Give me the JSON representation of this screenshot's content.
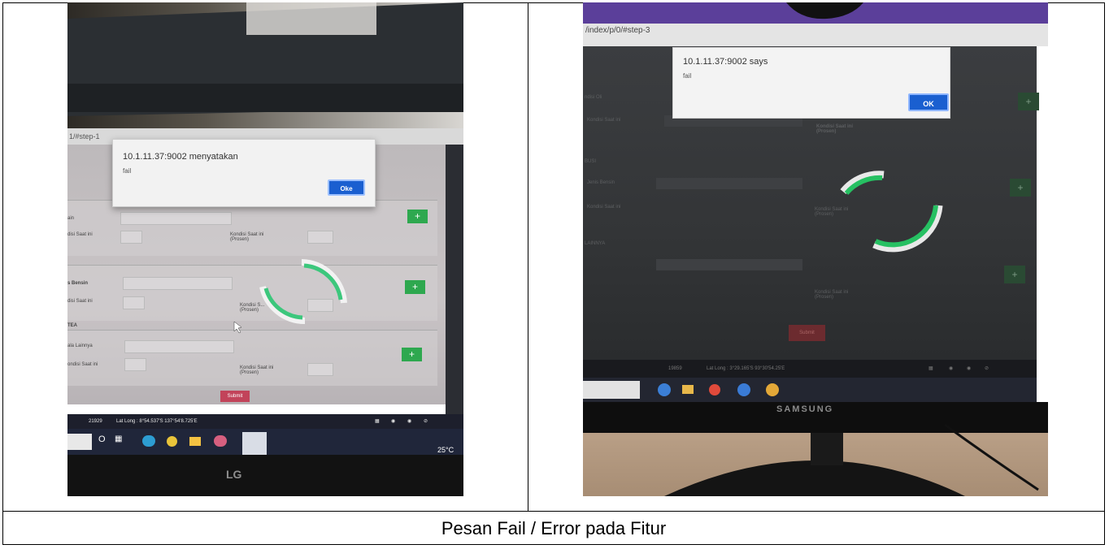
{
  "caption": "Pesan Fail / Error pada Fitur",
  "photo1": {
    "url_fragment": "1/#step-1",
    "dialog_title": "10.1.11.37:9002 menyatakan",
    "dialog_message": "fail",
    "ok_label": "Oke",
    "form_labels": [
      "ain",
      "disi Saat ini",
      "Kondisi Saat ini (Prosen)",
      "s Bensin",
      "disi Saat ini",
      "Kondisi S... (Prosen)",
      "TEA",
      "ala Lainnya",
      "ondisi Saat ini",
      "Kondisi Saat ini (Prosen)"
    ],
    "submit_label": "Submit",
    "status_text": "21929",
    "latlong": "Lat Long : 8°54.537'S 137°54'8.725'E",
    "temperature": "25°C",
    "brand": "LG"
  },
  "photo2": {
    "url_fragment": "/index/p/0/#step-3",
    "dialog_title": "10.1.11.37:9002 says",
    "dialog_message": "fail",
    "ok_label": "OK",
    "form_labels": [
      "ndisi Oli",
      "Kondisi Saat ini",
      "Kondisi Saat ini (Prosen)",
      "BUSI",
      "Jenis Bensin",
      "Kondisi Saat ini",
      "Kondisi Saat ini (Prosen)",
      "LAINNYA",
      "Kondisi Saat ini (Prosen)"
    ],
    "submit_label": "Submit",
    "status_text": "19859",
    "latlong": "Lat Long : 3°29.165'S 93°30'54.25'E",
    "brand": "SAMSUNG"
  }
}
